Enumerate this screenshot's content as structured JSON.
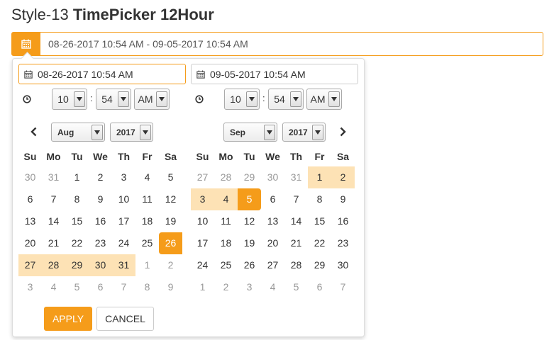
{
  "title": {
    "prefix": "Style-13",
    "bold": "TimePicker 12Hour"
  },
  "range_input": {
    "value": "08-26-2017 10:54 AM - 09-05-2017 10:54 AM"
  },
  "left": {
    "input": "08-26-2017 10:54 AM",
    "hour": "10",
    "minute": "54",
    "ampm": "AM",
    "month": "Aug",
    "year": "2017"
  },
  "right": {
    "input": "09-05-2017 10:54 AM",
    "hour": "10",
    "minute": "54",
    "ampm": "AM",
    "month": "Sep",
    "year": "2017"
  },
  "time_separator": ":",
  "weekdays": [
    "Su",
    "Mo",
    "Tu",
    "We",
    "Th",
    "Fr",
    "Sa"
  ],
  "left_weeks": [
    [
      {
        "d": "30",
        "s": "off"
      },
      {
        "d": "31",
        "s": "off"
      },
      {
        "d": "1"
      },
      {
        "d": "2"
      },
      {
        "d": "3"
      },
      {
        "d": "4"
      },
      {
        "d": "5"
      }
    ],
    [
      {
        "d": "6"
      },
      {
        "d": "7"
      },
      {
        "d": "8"
      },
      {
        "d": "9"
      },
      {
        "d": "10"
      },
      {
        "d": "11"
      },
      {
        "d": "12"
      }
    ],
    [
      {
        "d": "13"
      },
      {
        "d": "14"
      },
      {
        "d": "15"
      },
      {
        "d": "16"
      },
      {
        "d": "17"
      },
      {
        "d": "18"
      },
      {
        "d": "19"
      }
    ],
    [
      {
        "d": "20"
      },
      {
        "d": "21"
      },
      {
        "d": "22"
      },
      {
        "d": "23"
      },
      {
        "d": "24"
      },
      {
        "d": "25"
      },
      {
        "d": "26",
        "s": "start"
      }
    ],
    [
      {
        "d": "27",
        "s": "in"
      },
      {
        "d": "28",
        "s": "in"
      },
      {
        "d": "29",
        "s": "in"
      },
      {
        "d": "30",
        "s": "in"
      },
      {
        "d": "31",
        "s": "in"
      },
      {
        "d": "1",
        "s": "off"
      },
      {
        "d": "2",
        "s": "off"
      }
    ],
    [
      {
        "d": "3",
        "s": "off"
      },
      {
        "d": "4",
        "s": "off"
      },
      {
        "d": "5",
        "s": "off"
      },
      {
        "d": "6",
        "s": "off"
      },
      {
        "d": "7",
        "s": "off"
      },
      {
        "d": "8",
        "s": "off"
      },
      {
        "d": "9",
        "s": "off"
      }
    ]
  ],
  "right_weeks": [
    [
      {
        "d": "27",
        "s": "off"
      },
      {
        "d": "28",
        "s": "off"
      },
      {
        "d": "29",
        "s": "off"
      },
      {
        "d": "30",
        "s": "off"
      },
      {
        "d": "31",
        "s": "off"
      },
      {
        "d": "1",
        "s": "in"
      },
      {
        "d": "2",
        "s": "in"
      }
    ],
    [
      {
        "d": "3",
        "s": "in"
      },
      {
        "d": "4",
        "s": "in"
      },
      {
        "d": "5",
        "s": "end"
      },
      {
        "d": "6"
      },
      {
        "d": "7"
      },
      {
        "d": "8"
      },
      {
        "d": "9"
      }
    ],
    [
      {
        "d": "10"
      },
      {
        "d": "11"
      },
      {
        "d": "12"
      },
      {
        "d": "13"
      },
      {
        "d": "14"
      },
      {
        "d": "15"
      },
      {
        "d": "16"
      }
    ],
    [
      {
        "d": "17"
      },
      {
        "d": "18"
      },
      {
        "d": "19"
      },
      {
        "d": "20"
      },
      {
        "d": "21"
      },
      {
        "d": "22"
      },
      {
        "d": "23"
      }
    ],
    [
      {
        "d": "24"
      },
      {
        "d": "25"
      },
      {
        "d": "26"
      },
      {
        "d": "27"
      },
      {
        "d": "28"
      },
      {
        "d": "29"
      },
      {
        "d": "30"
      }
    ],
    [
      {
        "d": "1",
        "s": "off"
      },
      {
        "d": "2",
        "s": "off"
      },
      {
        "d": "3",
        "s": "off"
      },
      {
        "d": "4",
        "s": "off"
      },
      {
        "d": "5",
        "s": "off"
      },
      {
        "d": "6",
        "s": "off"
      },
      {
        "d": "7",
        "s": "off"
      }
    ]
  ],
  "buttons": {
    "apply": "APPLY",
    "cancel": "CANCEL"
  },
  "colors": {
    "accent": "#f59c1a",
    "range": "#fde2b5"
  },
  "icons": {
    "calendar": "calendar-icon",
    "clock": "clock-icon",
    "prev": "chevron-left-icon",
    "next": "chevron-right-icon"
  }
}
